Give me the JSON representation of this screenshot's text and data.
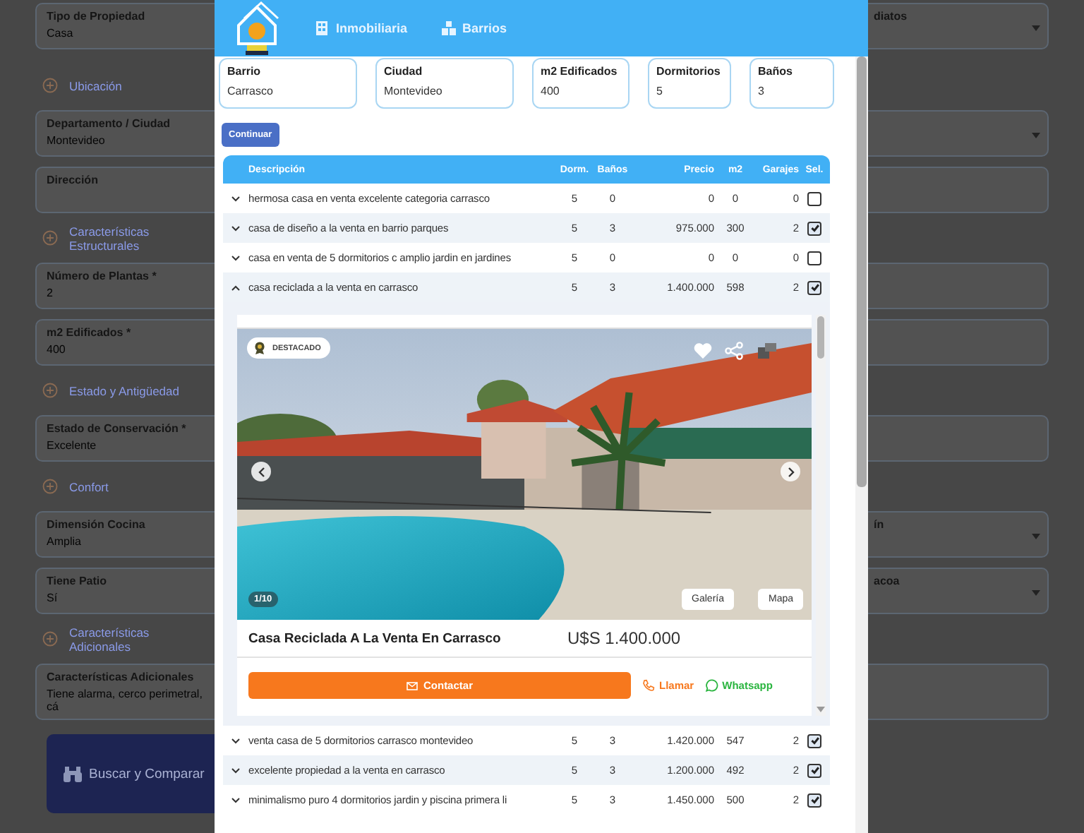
{
  "background": {
    "items": [
      {
        "kind": "pair",
        "left": {
          "label": "Tipo de Propiedad",
          "value": "Casa"
        },
        "right": {
          "label": "diatos",
          "dropdown": true
        }
      },
      {
        "kind": "section",
        "title": "Ubicación"
      },
      {
        "kind": "field",
        "label": "Departamento / Ciudad",
        "value": "Montevideo",
        "dropdown": true
      },
      {
        "kind": "field",
        "label": "Dirección",
        "dropdown": false
      },
      {
        "kind": "section",
        "title": "Características Estructurales"
      },
      {
        "kind": "field",
        "label": "Número de Plantas *",
        "value": "2",
        "dropdown": false
      },
      {
        "kind": "field",
        "label": "m2 Edificados *",
        "value": "400",
        "dropdown": false
      },
      {
        "kind": "section",
        "title": "Estado y Antigüedad"
      },
      {
        "kind": "field",
        "label": "Estado de Conservación *",
        "value": "Excelente",
        "dropdown": false
      },
      {
        "kind": "section",
        "title": "Confort"
      },
      {
        "kind": "pair",
        "left": {
          "label": "Dimensión Cocina",
          "value": "Amplia"
        },
        "right": {
          "label": "ín",
          "dropdown": true
        }
      },
      {
        "kind": "pair",
        "left": {
          "label": "Tiene Patio",
          "value": "Sí"
        },
        "right": {
          "label": "acoa",
          "dropdown": true
        }
      },
      {
        "kind": "section",
        "title": "Características Adicionales"
      },
      {
        "kind": "field",
        "label": "Características Adicionales",
        "value": "Tiene alarma, cerco perimetral, cá",
        "dropdown": false
      },
      {
        "kind": "button",
        "label": "Buscar y Comparar"
      }
    ]
  },
  "modal": {
    "nav": [
      {
        "label": "Inmobiliaria"
      },
      {
        "label": "Barrios"
      }
    ],
    "filters": [
      {
        "label": "Barrio",
        "value": "Carrasco"
      },
      {
        "label": "Ciudad",
        "value": "Montevideo"
      },
      {
        "label": "m2 Edificados",
        "value": "400"
      },
      {
        "label": "Dormitorios",
        "value": "5"
      },
      {
        "label": "Baños",
        "value": "3"
      }
    ],
    "continue_button": "Continuar",
    "table": {
      "columns": [
        "Descripción",
        "Dorm.",
        "Baños",
        "Precio",
        "m2",
        "Garajes",
        "Sel."
      ],
      "rows": [
        {
          "description": "hermosa casa en venta excelente categoria carrasco",
          "dorms": "5",
          "baths": "0",
          "price": "0",
          "m2": "0",
          "garages": "0",
          "selected": false,
          "expanded": false
        },
        {
          "description": "casa de diseño a la venta en barrio parques",
          "dorms": "5",
          "baths": "3",
          "price": "975.000",
          "m2": "300",
          "garages": "2",
          "selected": true,
          "expanded": false
        },
        {
          "description": "casa en venta de 5 dormitorios c amplio jardin en jardines",
          "dorms": "5",
          "baths": "0",
          "price": "0",
          "m2": "0",
          "garages": "0",
          "selected": false,
          "expanded": false
        },
        {
          "description": "casa reciclada a la venta en carrasco",
          "dorms": "5",
          "baths": "3",
          "price": "1.400.000",
          "m2": "598",
          "garages": "2",
          "selected": true,
          "expanded": true
        },
        {
          "description": "venta casa de 5 dormitorios carrasco montevideo",
          "dorms": "5",
          "baths": "3",
          "price": "1.420.000",
          "m2": "547",
          "garages": "2",
          "selected": true,
          "expanded": false
        },
        {
          "description": "excelente propiedad a la venta en carrasco",
          "dorms": "5",
          "baths": "3",
          "price": "1.200.000",
          "m2": "492",
          "garages": "2",
          "selected": true,
          "expanded": false
        },
        {
          "description": "minimalismo puro 4 dormitorios jardin y piscina primera li",
          "dorms": "5",
          "baths": "3",
          "price": "1.450.000",
          "m2": "500",
          "garages": "2",
          "selected": true,
          "expanded": false
        }
      ]
    },
    "listing": {
      "badge": "DESTACADO",
      "counter": "1/10",
      "gallery_button": "Galería",
      "map_button": "Mapa",
      "title": "Casa Reciclada A La Venta En Carrasco",
      "price": "U$S 1.400.000",
      "contact_button": "Contactar",
      "call_link": "Llamar",
      "whatsapp_link": "Whatsapp"
    }
  }
}
